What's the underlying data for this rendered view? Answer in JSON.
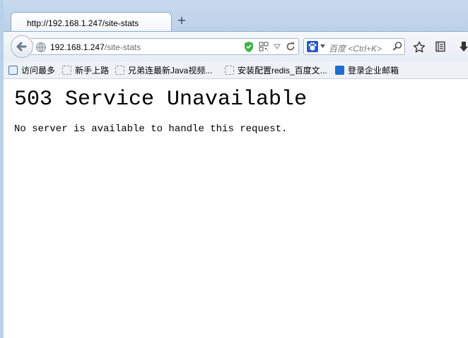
{
  "tab": {
    "title": "http://192.168.1.247/site-stats",
    "new_tab_label": "+"
  },
  "navbar": {
    "url_host": "192.168.1.247",
    "url_path": "/site-stats",
    "search_placeholder": "百度 <Ctrl+K>"
  },
  "bookmarks": [
    {
      "label": "访问最多",
      "icon": "most-visited-icon"
    },
    {
      "label": "新手上路",
      "icon": "page-icon"
    },
    {
      "label": "兄弟连最新Java视频...",
      "icon": "page-icon"
    },
    {
      "label": "安装配置redis_百度文...",
      "icon": "page-icon"
    },
    {
      "label": "登录企业邮箱",
      "icon": "mail-icon"
    }
  ],
  "page": {
    "title": "503 Service Unavailable",
    "message": "No server is available to handle this request."
  },
  "colors": {
    "chrome": "#c9daee",
    "accent": "#2b57c8",
    "shield": "#3bb54a"
  }
}
